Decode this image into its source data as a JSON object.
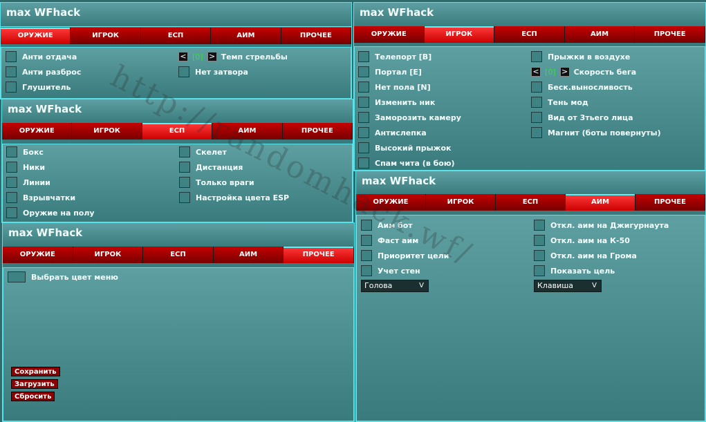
{
  "window_title": "max WFhack",
  "tabs": [
    "ОРУЖИЕ",
    "ИГРОК",
    "ЕСП",
    "АИМ",
    "ПРОЧЕЕ"
  ],
  "weapon": {
    "left": [
      "Анти отдача",
      "Анти разброс",
      "Глушитель"
    ],
    "fire_rate": {
      "prev": "<",
      "value": "[0]",
      "next": ">",
      "label": "Темп стрельбы"
    },
    "right": [
      "Нет затвора"
    ]
  },
  "player": {
    "left": [
      "Телепорт [B]",
      "Портал [E]",
      "Нет пола [N]",
      "Изменить ник",
      "Заморозить камеру",
      "Антислепка",
      "Высокий прыжок",
      "Спам чита (в бою)"
    ],
    "right_top": [
      "Прыжки в воздухе"
    ],
    "speed": {
      "prev": "<",
      "value": "[0]",
      "next": ">",
      "label": "Скорость бега"
    },
    "right": [
      "Беск.выносливость",
      "Тень мод",
      "Вид от 3тьего лица",
      "Магнит (боты повернуты)"
    ]
  },
  "esp": {
    "left": [
      "Бокс",
      "Ники",
      "Линии",
      "Взрывчатки",
      "Оружие на полу"
    ],
    "right": [
      "Скелет",
      "Дистанция",
      "Только враги",
      "Настройка цвета ESP"
    ]
  },
  "aim": {
    "left": [
      "Аим бот",
      "Фаст аим",
      "Приоритет цели",
      "Учет стен"
    ],
    "right": [
      "Откл. аим на Джигурнаута",
      "Откл. аим на К-50",
      "Откл. аим на Грома",
      "Показать цель"
    ],
    "bone_dropdown": "Голова",
    "key_dropdown": "Клавиша",
    "dropdown_arrow": "V"
  },
  "misc": {
    "menu_color": "Выбрать цвет меню",
    "buttons": [
      "Сохранить",
      "Загрузить",
      "Сбросить"
    ]
  },
  "watermark": "http://randomhack.wf/",
  "colors": {
    "accent": "#58e3ea",
    "tab_red": "#c50000",
    "value_green": "#34e234"
  }
}
